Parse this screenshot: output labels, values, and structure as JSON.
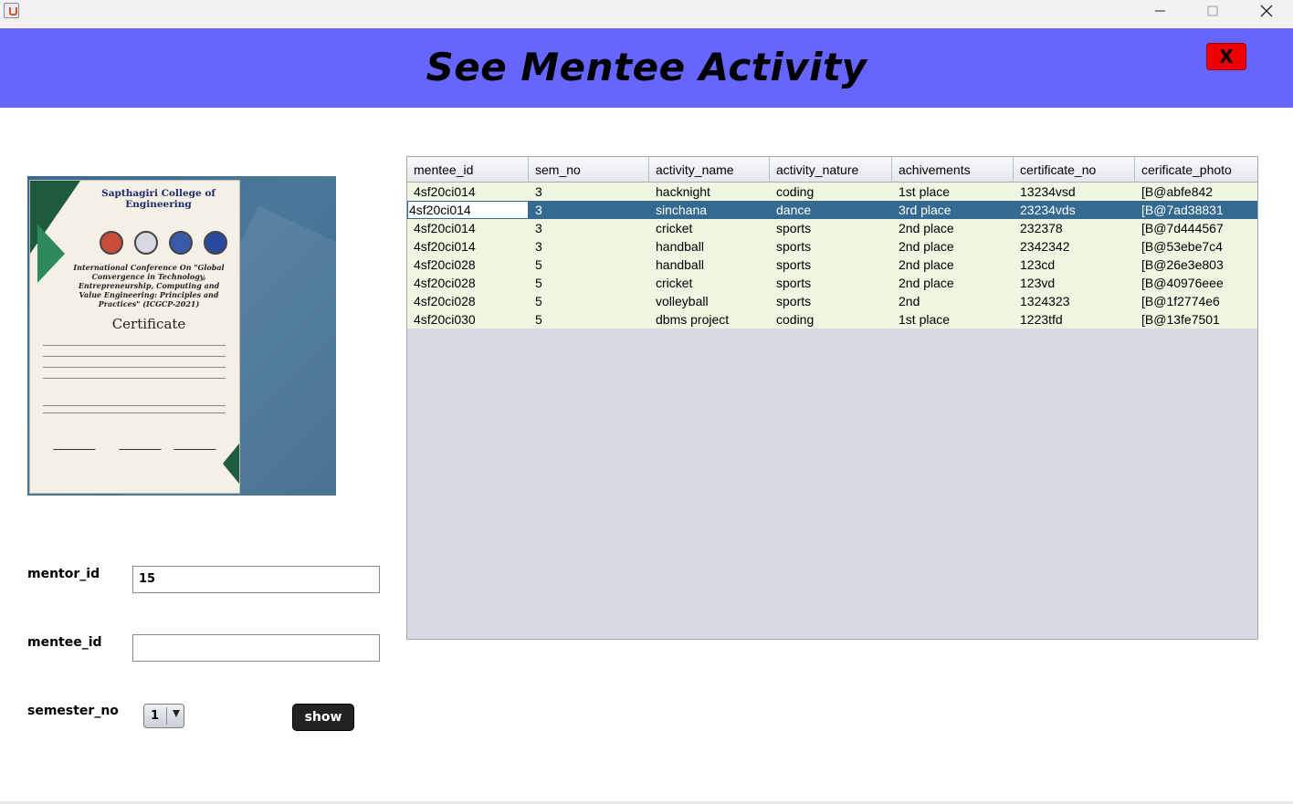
{
  "window": {
    "buttons": {
      "minimize": "minimize-icon",
      "maximize": "maximize-icon",
      "close": "close-icon"
    }
  },
  "header": {
    "title": "See Mentee Activity",
    "close_label": "X",
    "colors": {
      "header_bg": "#6666ff",
      "close_bg": "#ee0000"
    }
  },
  "form": {
    "mentor_id_label": "mentor_id",
    "mentor_id_value": "15",
    "mentee_id_label": "mentee_id",
    "mentee_id_value": "",
    "semester_label": "semester_no",
    "semester_value": "1",
    "show_label": "show"
  },
  "certificate": {
    "college": "Sapthagiri College of Engineering",
    "conference": "International Conference On \"Global Convergence in Technology, Entrepreneurship, Computing and Value Engineering: Principles and Practices\" (ICGCP-2021)",
    "heading": "Certificate"
  },
  "table": {
    "columns": [
      "mentee_id",
      "sem_no",
      "activity_name",
      "activity_nature",
      "achivements",
      "certificate_no",
      "cerificate_photo"
    ],
    "selected_row": 1,
    "rows": [
      [
        "4sf20ci014",
        "3",
        "hacknight",
        "coding",
        "1st place",
        "13234vsd",
        "[B@abfe842"
      ],
      [
        "4sf20ci014",
        "3",
        "sinchana",
        "dance",
        "3rd place",
        "23234vds",
        "[B@7ad38831"
      ],
      [
        "4sf20ci014",
        "3",
        "cricket",
        "sports",
        "2nd place",
        "232378",
        "[B@7d444567"
      ],
      [
        "4sf20ci014",
        "3",
        "handball",
        "sports",
        "2nd place",
        "2342342",
        "[B@53ebe7c4"
      ],
      [
        "4sf20ci028",
        "5",
        "handball",
        "sports",
        "2nd place",
        "123cd",
        "[B@26e3e803"
      ],
      [
        "4sf20ci028",
        "5",
        "cricket",
        "sports",
        "2nd place",
        "123vd",
        "[B@40976eee"
      ],
      [
        "4sf20ci028",
        "5",
        "volleyball",
        "sports",
        "2nd",
        "1324323",
        "[B@1f2774e6"
      ],
      [
        "4sf20ci030",
        "5",
        "dbms project",
        "coding",
        "1st place",
        "1223tfd",
        "[B@13fe7501"
      ]
    ],
    "colors": {
      "row_bg": "#eef6e2",
      "selected_bg": "#346a8f",
      "panel_bg": "#d7dae1"
    }
  }
}
